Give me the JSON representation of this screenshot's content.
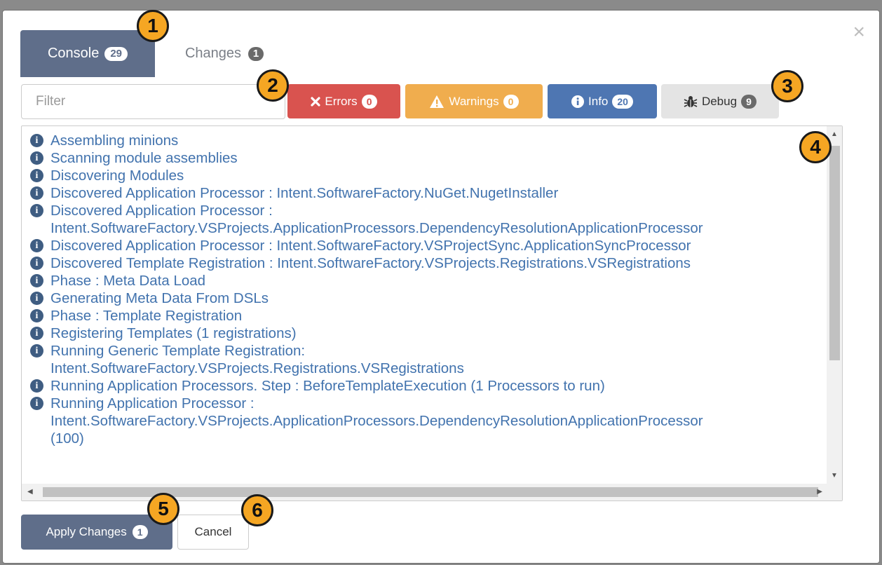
{
  "dialog": {
    "close_symbol": "×"
  },
  "tabs": [
    {
      "label": "Console",
      "count": "29"
    },
    {
      "label": "Changes",
      "count": "1"
    }
  ],
  "filter": {
    "placeholder": "Filter",
    "value": ""
  },
  "levels": {
    "errors": {
      "label": "Errors",
      "count": "0",
      "icon": "times-icon",
      "color": "#d9534f"
    },
    "warnings": {
      "label": "Warnings",
      "count": "0",
      "icon": "warning-icon",
      "color": "#f0ad4e"
    },
    "info": {
      "label": "Info",
      "count": "20",
      "icon": "info-icon",
      "color": "#4e76b2"
    },
    "debug": {
      "label": "Debug",
      "count": "9",
      "icon": "bug-icon",
      "color": "#e4e4e4"
    }
  },
  "log": {
    "entries": [
      [
        "Assembling minions"
      ],
      [
        "Scanning module assemblies"
      ],
      [
        "Discovering Modules"
      ],
      [
        "Discovered Application Processor : Intent.SoftwareFactory.NuGet.NugetInstaller"
      ],
      [
        "Discovered Application Processor :",
        "Intent.SoftwareFactory.VSProjects.ApplicationProcessors.DependencyResolutionApplicationProcessor"
      ],
      [
        "Discovered Application Processor : Intent.SoftwareFactory.VSProjectSync.ApplicationSyncProcessor"
      ],
      [
        "Discovered Template Registration : Intent.SoftwareFactory.VSProjects.Registrations.VSRegistrations"
      ],
      [
        "Phase : Meta Data Load"
      ],
      [
        "Generating Meta Data From DSLs"
      ],
      [
        "Phase : Template Registration"
      ],
      [
        "Registering Templates (1 registrations)"
      ],
      [
        "Running Generic Template Registration:",
        "Intent.SoftwareFactory.VSProjects.Registrations.VSRegistrations"
      ],
      [
        "Running Application Processors. Step : BeforeTemplateExecution (1 Processors to run)"
      ],
      [
        "Running Application Processor :",
        "Intent.SoftwareFactory.VSProjects.ApplicationProcessors.DependencyResolutionApplicationProcessor",
        "(100)"
      ]
    ]
  },
  "footer": {
    "apply_label": "Apply Changes",
    "apply_count": "1",
    "cancel_label": "Cancel"
  },
  "callouts": [
    "1",
    "2",
    "3",
    "4",
    "5",
    "6"
  ]
}
